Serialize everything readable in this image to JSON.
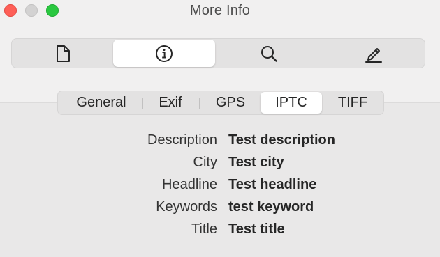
{
  "window": {
    "title": "More Info"
  },
  "toolbar": {
    "items": [
      {
        "icon": "document-icon",
        "active": false
      },
      {
        "icon": "info-circle-icon",
        "active": true
      },
      {
        "icon": "search-icon",
        "active": false
      },
      {
        "icon": "markup-pencil-icon",
        "active": false
      }
    ]
  },
  "tabs": [
    {
      "label": "General",
      "active": false
    },
    {
      "label": "Exif",
      "active": false
    },
    {
      "label": "GPS",
      "active": false
    },
    {
      "label": "IPTC",
      "active": true
    },
    {
      "label": "TIFF",
      "active": false
    }
  ],
  "iptc": [
    {
      "label": "Description",
      "value": "Test description"
    },
    {
      "label": "City",
      "value": "Test city"
    },
    {
      "label": "Headline",
      "value": "Test headline"
    },
    {
      "label": "Keywords",
      "value": "test keyword"
    },
    {
      "label": "Title",
      "value": "Test title"
    }
  ],
  "colors": {
    "close": "#fe5f57",
    "minimize": "#d3d2d2",
    "zoom": "#2ac840"
  }
}
